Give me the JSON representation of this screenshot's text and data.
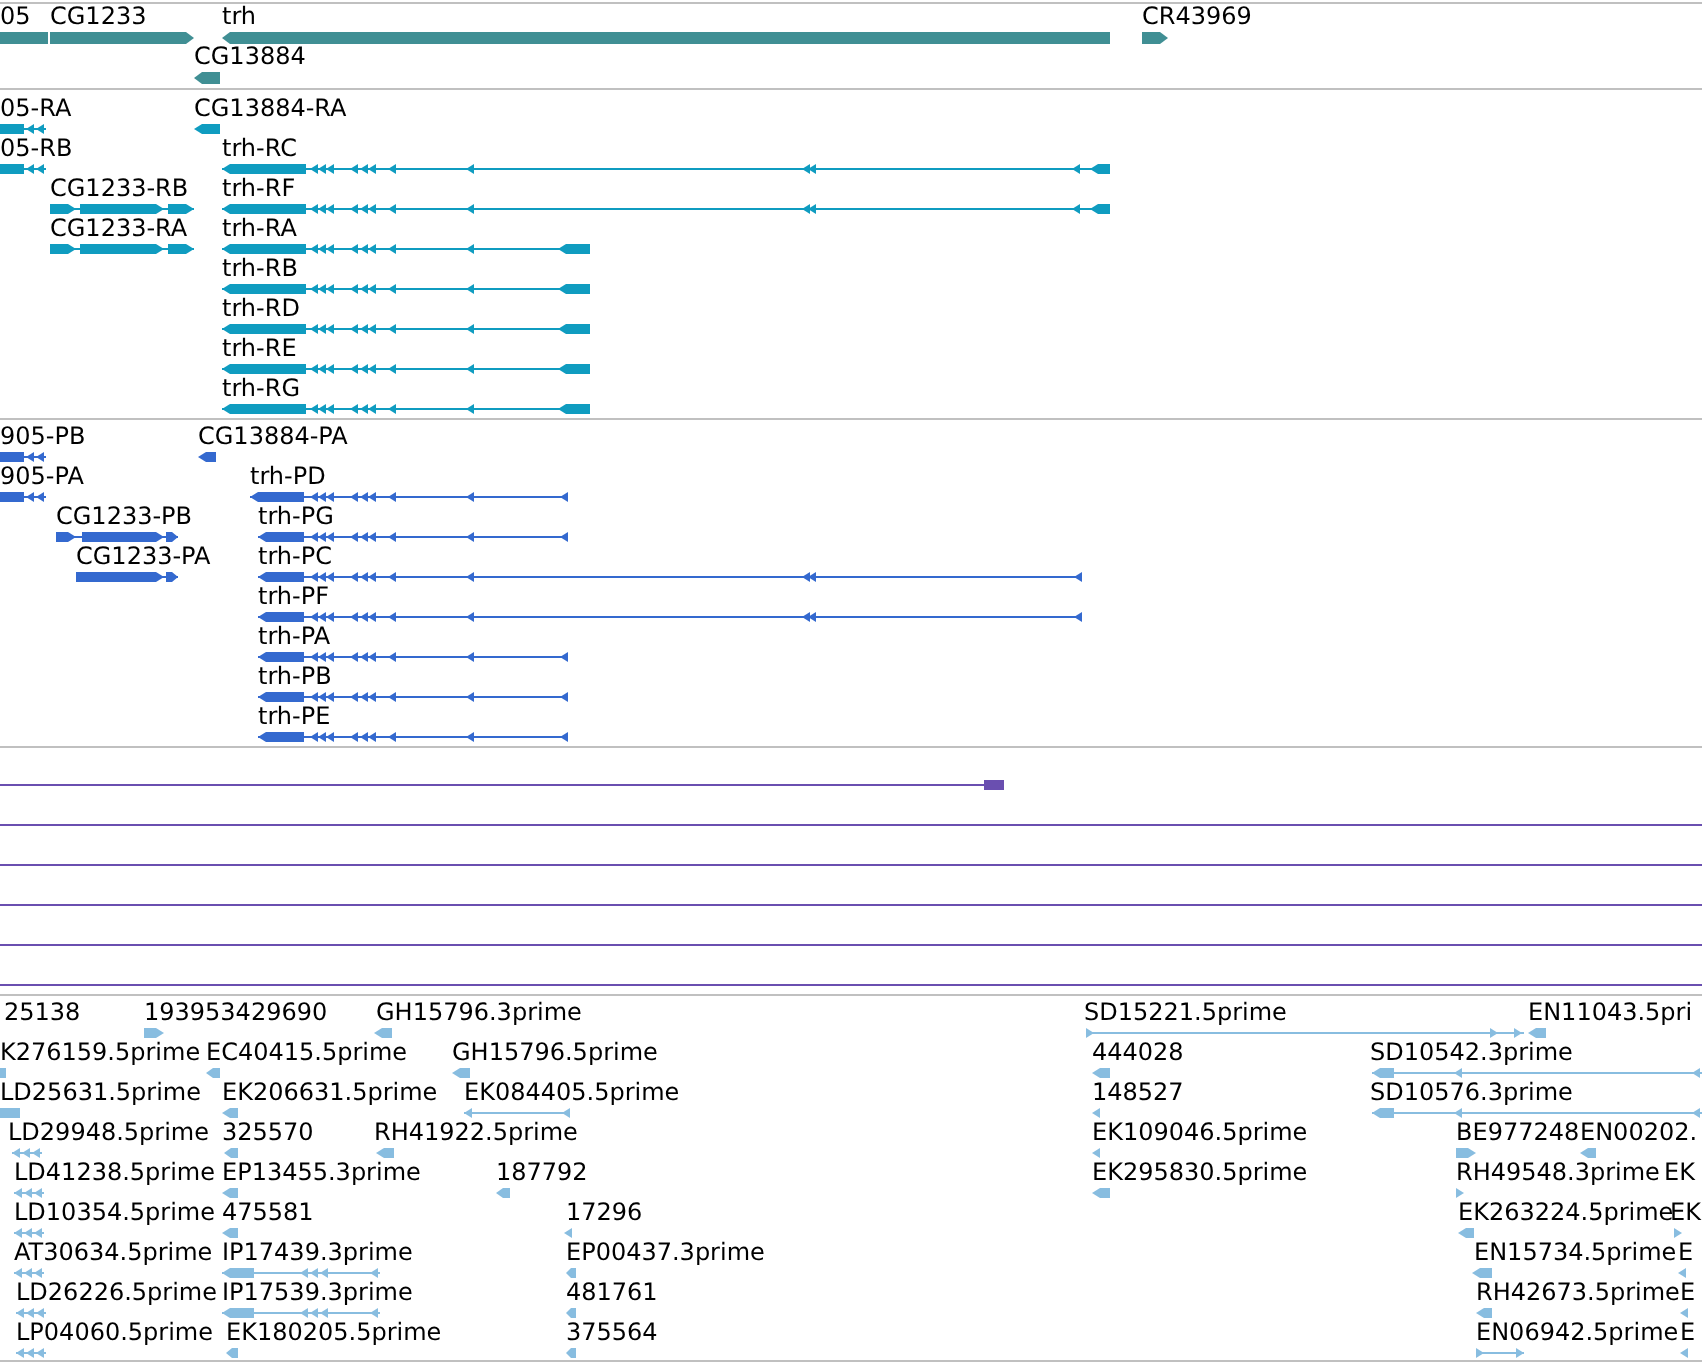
{
  "tracks": [
    {
      "kind": "genes",
      "color": "#408f94",
      "features": [
        {
          "label": "05"
        },
        {
          "label": "CG1233",
          "reverse": false
        },
        {
          "label": "trh",
          "reverse": true
        },
        {
          "label": "CR43969",
          "reverse": false
        },
        {
          "label": "CG13884",
          "reverse": true
        }
      ]
    },
    {
      "kind": "transcripts",
      "color": "#0f9cc0",
      "features": [
        {
          "label": "05-RA",
          "reverse": true
        },
        {
          "label": "CG13884-RA",
          "reverse": true
        },
        {
          "label": "05-RB",
          "reverse": true
        },
        {
          "label": "trh-RC",
          "reverse": true
        },
        {
          "label": "CG1233-RB",
          "reverse": false
        },
        {
          "label": "trh-RF",
          "reverse": true
        },
        {
          "label": "CG1233-RA",
          "reverse": false
        },
        {
          "label": "trh-RA",
          "reverse": true
        },
        {
          "label": "trh-RB",
          "reverse": true
        },
        {
          "label": "trh-RD",
          "reverse": true
        },
        {
          "label": "trh-RE",
          "reverse": true
        },
        {
          "label": "trh-RG",
          "reverse": true
        }
      ]
    },
    {
      "kind": "proteins",
      "color": "#3469cf",
      "features": [
        {
          "label": "905-PB",
          "reverse": true
        },
        {
          "label": "CG13884-PA",
          "reverse": true
        },
        {
          "label": "905-PA",
          "reverse": true
        },
        {
          "label": "trh-PD",
          "reverse": true
        },
        {
          "label": "CG1233-PB",
          "reverse": false
        },
        {
          "label": "trh-PG",
          "reverse": true
        },
        {
          "label": "CG1233-PA",
          "reverse": false
        },
        {
          "label": "trh-PC",
          "reverse": true
        },
        {
          "label": "trh-PF",
          "reverse": true
        },
        {
          "label": "trh-PA",
          "reverse": true
        },
        {
          "label": "trh-PB",
          "reverse": true
        },
        {
          "label": "trh-PE",
          "reverse": true
        }
      ]
    },
    {
      "kind": "lines",
      "color": "#6a4fb0"
    },
    {
      "kind": "ests",
      "color": "#88bde0",
      "features": [
        {
          "label": "25138"
        },
        {
          "label": "193953429690",
          "reverse": false
        },
        {
          "label": "GH15796.3prime",
          "reverse": true
        },
        {
          "label": "SD15221.5prime",
          "reverse": false
        },
        {
          "label": "EN11043.5pri",
          "reverse": true
        },
        {
          "label": "K276159.5prime"
        },
        {
          "label": "EC40415.5prime",
          "reverse": true
        },
        {
          "label": "GH15796.5prime",
          "reverse": true
        },
        {
          "label": "444028",
          "reverse": true
        },
        {
          "label": "SD10542.3prime",
          "reverse": true
        },
        {
          "label": "LD25631.5prime"
        },
        {
          "label": "EK206631.5prime",
          "reverse": true
        },
        {
          "label": "EK084405.5prime",
          "reverse": true
        },
        {
          "label": "148527",
          "reverse": true
        },
        {
          "label": "SD10576.3prime",
          "reverse": true
        },
        {
          "label": "LD29948.5prime",
          "reverse": true
        },
        {
          "label": "325570",
          "reverse": true
        },
        {
          "label": "RH41922.5prime",
          "reverse": true
        },
        {
          "label": "EK109046.5prime",
          "reverse": true
        },
        {
          "label": "BE977248",
          "reverse": false
        },
        {
          "label": "EN00202.",
          "reverse": true
        },
        {
          "label": "LD41238.5prime",
          "reverse": true
        },
        {
          "label": "EP13455.3prime",
          "reverse": true
        },
        {
          "label": "187792",
          "reverse": true
        },
        {
          "label": "EK295830.5prime",
          "reverse": true
        },
        {
          "label": "RH49548.3prime",
          "reverse": false
        },
        {
          "label": "EK"
        },
        {
          "label": "LD10354.5prime",
          "reverse": true
        },
        {
          "label": "475581",
          "reverse": true
        },
        {
          "label": "17296",
          "reverse": true
        },
        {
          "label": "EK263224.5prime",
          "reverse": true
        },
        {
          "label": "EK",
          "reverse": false
        },
        {
          "label": "AT30634.5prime",
          "reverse": true
        },
        {
          "label": "IP17439.3prime",
          "reverse": true
        },
        {
          "label": "EP00437.3prime",
          "reverse": true
        },
        {
          "label": "EN15734.5prime",
          "reverse": true
        },
        {
          "label": "E",
          "reverse": true
        },
        {
          "label": "LD26226.5prime",
          "reverse": true
        },
        {
          "label": "IP17539.3prime",
          "reverse": true
        },
        {
          "label": "481761",
          "reverse": true
        },
        {
          "label": "RH42673.5prime",
          "reverse": true
        },
        {
          "label": "E",
          "reverse": true
        },
        {
          "label": "LP04060.5prime",
          "reverse": true
        },
        {
          "label": "EK180205.5prime",
          "reverse": true
        },
        {
          "label": "375564",
          "reverse": true
        },
        {
          "label": "EN06942.5prime",
          "reverse": false
        },
        {
          "label": "E",
          "reverse": true
        }
      ]
    }
  ]
}
